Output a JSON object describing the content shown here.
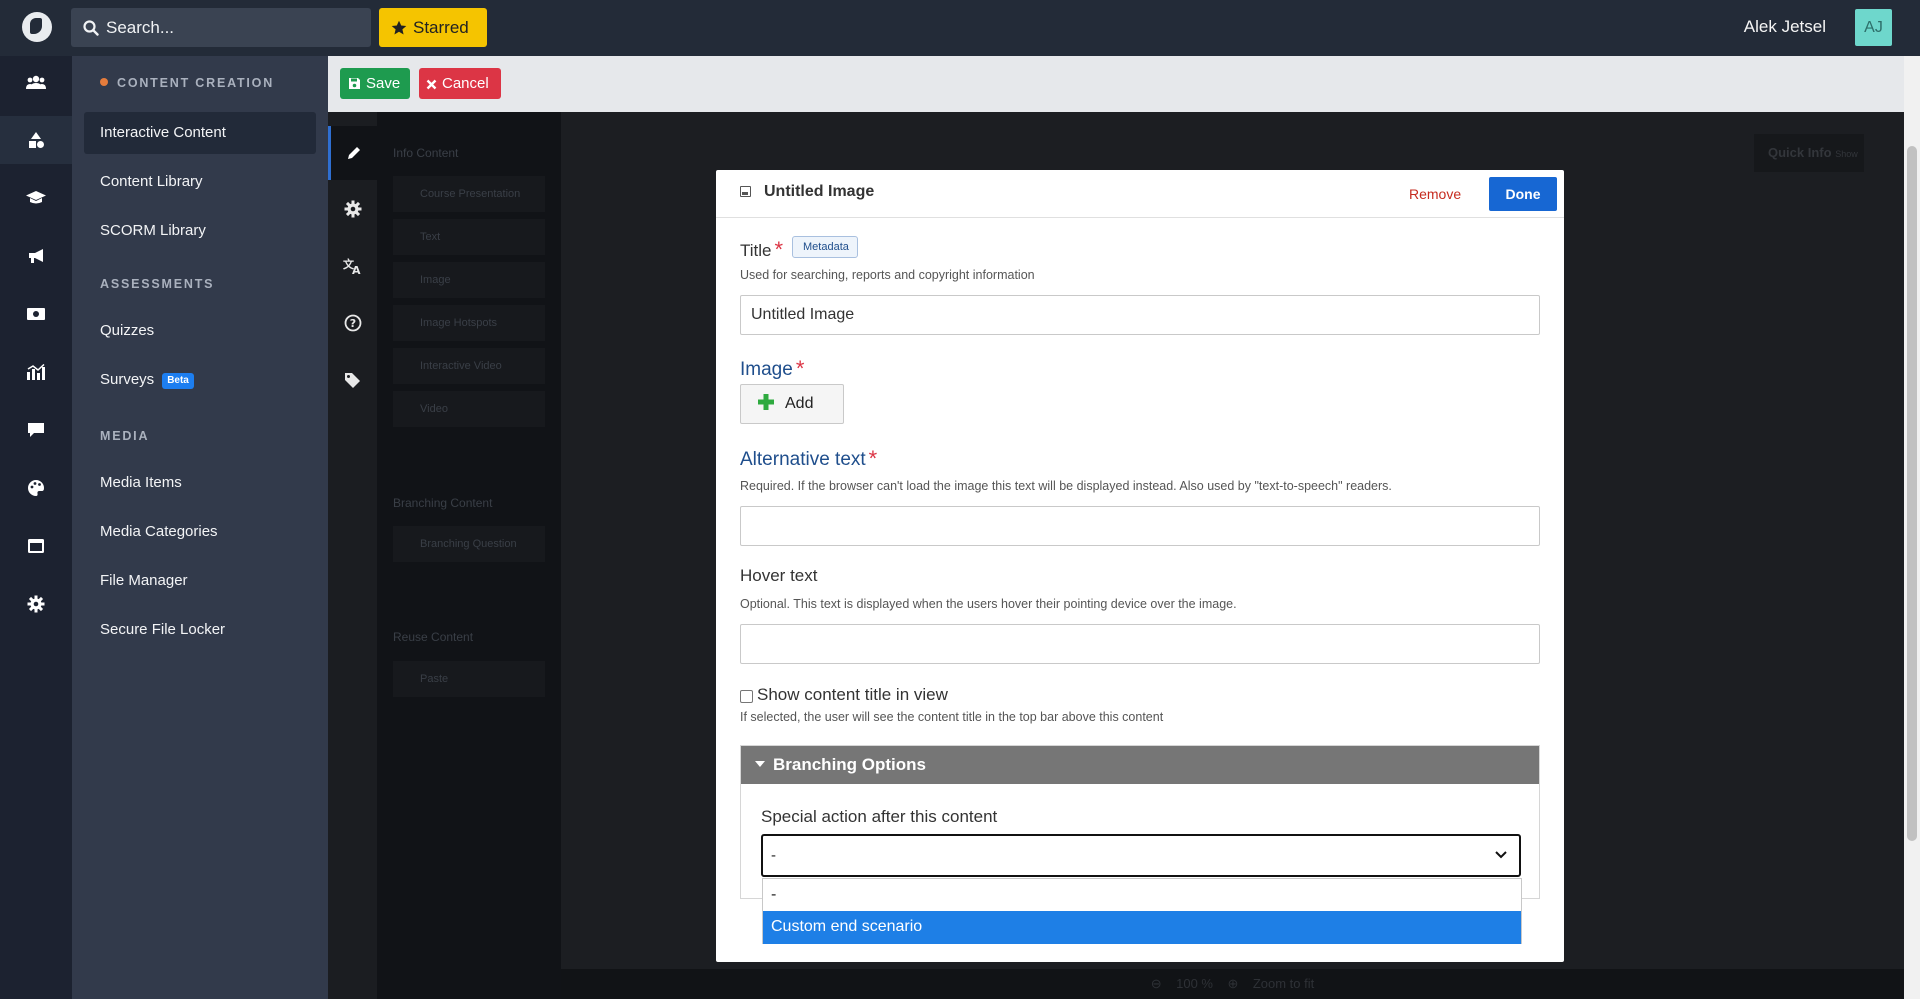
{
  "topbar": {
    "search_placeholder": "Search...",
    "starred_label": "Starred",
    "user_name": "Alek Jetsel",
    "user_initials": "AJ"
  },
  "rail": {
    "icons": [
      "users-icon",
      "shapes-icon",
      "graduation-cap-icon",
      "megaphone-icon",
      "money-icon",
      "chart-icon",
      "comment-icon",
      "palette-icon",
      "window-icon",
      "gear-icon"
    ]
  },
  "nav": {
    "sections": [
      {
        "title": "CONTENT CREATION",
        "items": [
          "Interactive Content",
          "Content Library",
          "SCORM Library"
        ]
      },
      {
        "title": "ASSESSMENTS",
        "items": [
          "Quizzes",
          "Surveys"
        ]
      },
      {
        "title": "MEDIA",
        "items": [
          "Media Items",
          "Media Categories",
          "File Manager",
          "Secure File Locker"
        ]
      }
    ],
    "beta_badge": "Beta"
  },
  "editor": {
    "save_label": "Save",
    "cancel_label": "Cancel",
    "content_list": {
      "info_heading": "Info Content",
      "info_items": [
        "Course Presentation",
        "Text",
        "Image",
        "Image Hotspots",
        "Interactive Video",
        "Video"
      ],
      "branching_heading": "Branching Content",
      "branching_items": [
        "Branching Question"
      ],
      "reuse_heading": "Reuse Content",
      "reuse_items": [
        "Paste"
      ]
    },
    "quick_info": "Quick Info",
    "quick_info_toggle": "Show",
    "zoom_level": "100 %",
    "zoom_to_fit": "Zoom to fit"
  },
  "modal": {
    "title": "Untitled Image",
    "remove_label": "Remove",
    "done_label": "Done",
    "fields": {
      "title_label": "Title",
      "metadata_label": "Metadata",
      "title_help": "Used for searching, reports and copyright information",
      "title_value": "Untitled Image",
      "image_label": "Image",
      "add_label": "Add",
      "alt_label": "Alternative text",
      "alt_help": "Required. If the browser can't load the image this text will be displayed instead. Also used by \"text-to-speech\" readers.",
      "alt_value": "",
      "hover_label": "Hover text",
      "hover_help": "Optional. This text is displayed when the users hover their pointing device over the image.",
      "hover_value": "",
      "show_title_label": "Show content title in view",
      "show_title_help": "If selected, the user will see the content title in the top bar above this content",
      "required_mark": "*"
    },
    "branching": {
      "heading": "Branching Options",
      "special_action_label": "Special action after this content",
      "selected_value": "-",
      "options": [
        "-",
        "Custom end scenario"
      ]
    }
  },
  "colors": {
    "accent_blue": "#1767d3",
    "save_green": "#1e9b4f",
    "cancel_red": "#dc3545",
    "starred_yellow": "#f5c400",
    "option_highlight": "#1e7fe6"
  }
}
